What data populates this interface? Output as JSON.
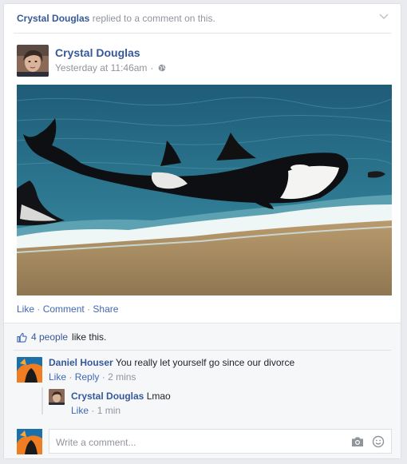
{
  "story": {
    "actor": "Crystal Douglas",
    "action_text": "replied to a comment on this."
  },
  "post": {
    "author": "Crystal Douglas",
    "timestamp": "Yesterday at 11:46am",
    "separator": "·",
    "privacy_icon": "globe-icon",
    "photo_icon": "orca-whales-on-beach-photo"
  },
  "actions": {
    "like": "Like",
    "comment": "Comment",
    "share": "Share",
    "sep": "·"
  },
  "likes": {
    "count_text": "4 people",
    "suffix": "like this.",
    "icon": "thumbs-up-icon"
  },
  "comments": [
    {
      "author": "Daniel Houser",
      "text": "You really let yourself go since our divorce",
      "like": "Like",
      "reply": "Reply",
      "time": "2 mins",
      "sep": "·"
    }
  ],
  "reply": {
    "author": "Crystal Douglas",
    "text": "Lmao",
    "like": "Like",
    "time": "1 min",
    "sep": "·"
  },
  "composer": {
    "placeholder": "Write a comment...",
    "camera_icon": "camera-icon",
    "smiley_icon": "smiley-icon"
  },
  "colors": {
    "link_blue": "#365899",
    "action_blue": "#4267b2",
    "meta_grey": "#90949c"
  }
}
